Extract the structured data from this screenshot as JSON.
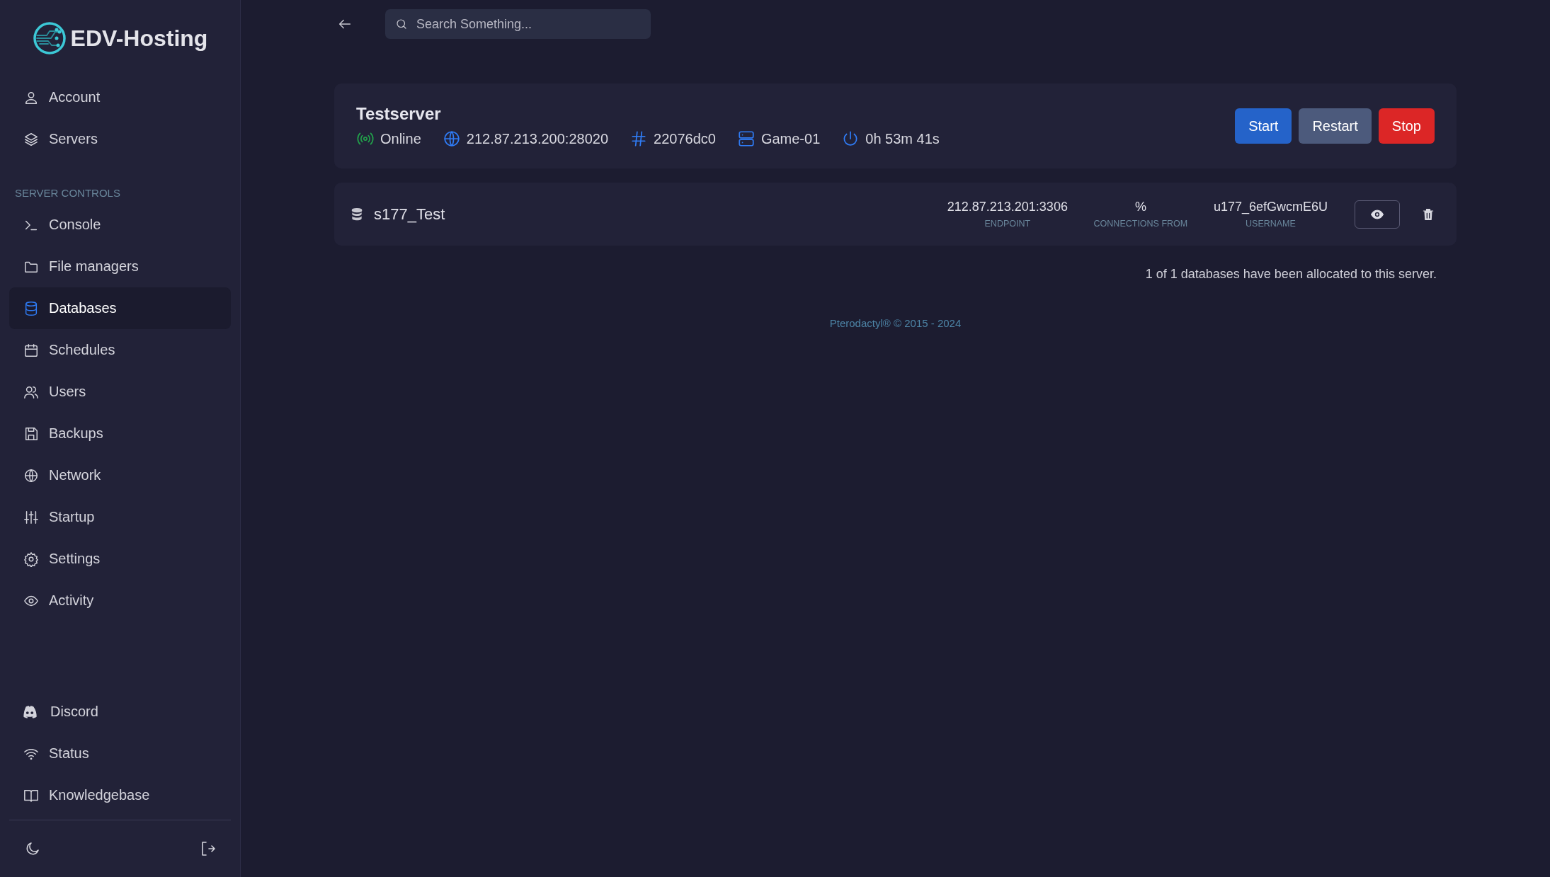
{
  "brand": {
    "name": "EDV-Hosting"
  },
  "sidebar": {
    "account_items": [
      {
        "label": "Account",
        "selected": false
      },
      {
        "label": "Servers",
        "selected": false
      }
    ],
    "section_label": "SERVER CONTROLS",
    "control_items": [
      {
        "label": "Console",
        "selected": false
      },
      {
        "label": "File managers",
        "selected": false
      },
      {
        "label": "Databases",
        "selected": true
      },
      {
        "label": "Schedules",
        "selected": false
      },
      {
        "label": "Users",
        "selected": false
      },
      {
        "label": "Backups",
        "selected": false
      },
      {
        "label": "Network",
        "selected": false
      },
      {
        "label": "Startup",
        "selected": false
      },
      {
        "label": "Settings",
        "selected": false
      },
      {
        "label": "Activity",
        "selected": false
      }
    ],
    "link_items": [
      {
        "label": "Discord"
      },
      {
        "label": "Status"
      },
      {
        "label": "Knowledgebase"
      }
    ]
  },
  "search": {
    "placeholder": "Search Something..."
  },
  "server": {
    "title": "Testserver",
    "info": [
      {
        "kind": "status",
        "text": "Online",
        "color": "#22a04b"
      },
      {
        "kind": "address",
        "text": "212.87.213.200:28020",
        "color": "#2f7cf6"
      },
      {
        "kind": "id",
        "text": "22076dc0",
        "color": "#2f7cf6"
      },
      {
        "kind": "node",
        "text": "Game-01",
        "color": "#2f7cf6"
      },
      {
        "kind": "uptime",
        "text": "0h 53m 41s",
        "color": "#2f7cf6"
      }
    ],
    "buttons": [
      {
        "kind": "start",
        "label": "Start"
      },
      {
        "kind": "restart",
        "label": "Restart"
      },
      {
        "kind": "stop",
        "label": "Stop"
      }
    ]
  },
  "databases": [
    {
      "name": "s177_Test",
      "fields": [
        {
          "value": "212.87.213.201:3306",
          "label": "ENDPOINT"
        },
        {
          "value": "%",
          "label": "CONNECTIONS FROM"
        },
        {
          "value": "u177_6efGwcmE6U",
          "label": "USERNAME"
        }
      ]
    }
  ],
  "allocation_note": "1 of 1 databases have been allocated to this server.",
  "footer": "Pterodactyl® © 2015 - 2024"
}
